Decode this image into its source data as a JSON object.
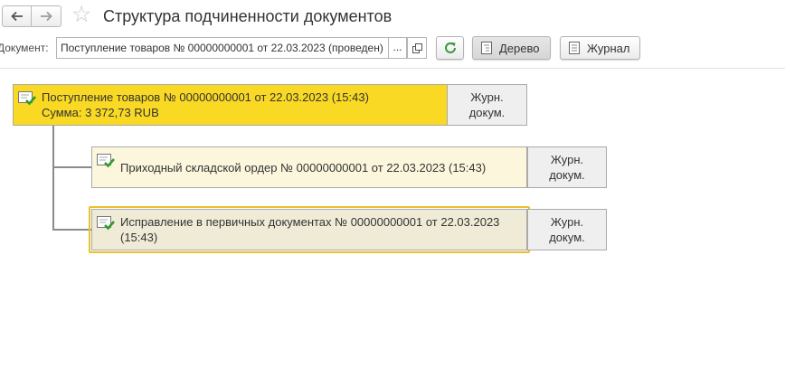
{
  "header": {
    "back_icon": "arrow-left-icon",
    "forward_icon": "arrow-right-icon",
    "favorite_icon": "star-icon",
    "title": "Структура подчиненности документов"
  },
  "toolbar": {
    "document_label": "Документ:",
    "document_value": "Поступление товаров № 00000000001 от 22.03.2023 (проведен)",
    "select_button_label": "...",
    "refresh_icon": "refresh-icon",
    "tree_button_label": "Дерево",
    "journal_button_label": "Журнал",
    "refresh_color": "#3a9a3a"
  },
  "tree": {
    "nodes": [
      {
        "line1": "Поступление товаров № 00000000001 от 22.03.2023 (15:43)",
        "line2": "Сумма: 3 372,73 RUB",
        "journal_line1": "Журн.",
        "journal_line2": "докум.",
        "color": "#f9d924"
      },
      {
        "line1": "Приходный складской ордер № 00000000001 от 22.03.2023 (15:43)",
        "journal_line1": "Журн.",
        "journal_line2": "докум.",
        "color": "#fcf7dc"
      },
      {
        "line1": "Исправление в первичных документах № 00000000001 от 22.03.2023",
        "line2": "(15:43)",
        "journal_line1": "Журн.",
        "journal_line2": "докум.",
        "color": "#f0ebd6"
      }
    ]
  }
}
